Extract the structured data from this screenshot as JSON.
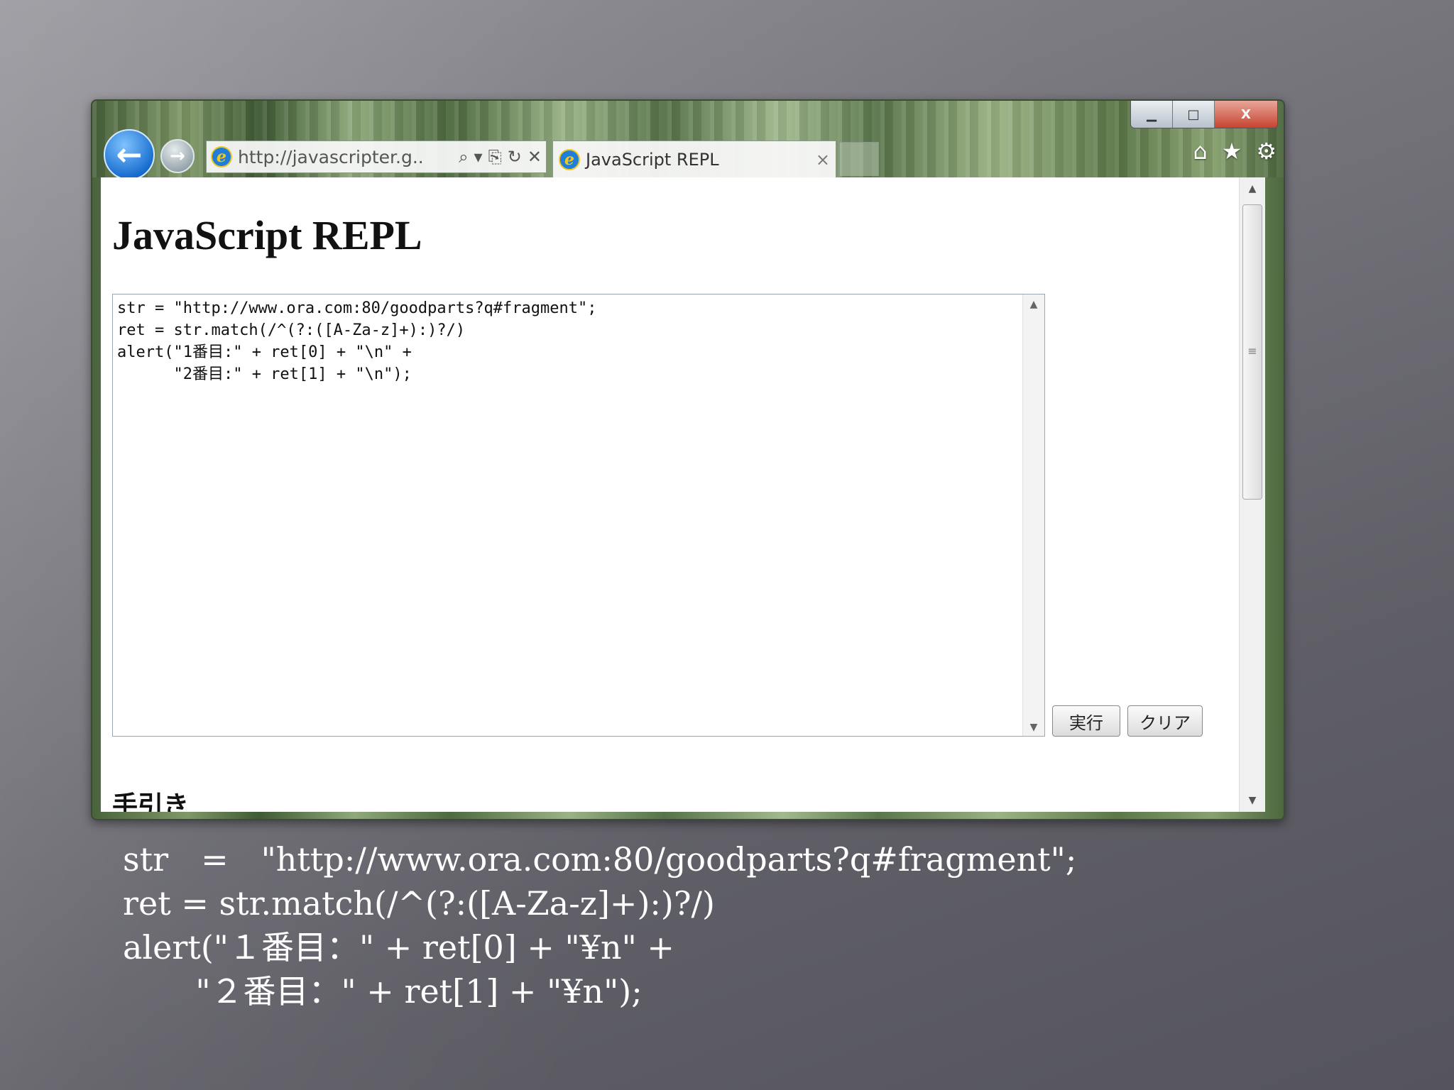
{
  "browser": {
    "window_controls": {
      "minimize": "▁",
      "maximize": "□",
      "close": "X"
    },
    "nav": {
      "back_icon": "←",
      "forward_icon": "→"
    },
    "address": {
      "url": "http://javascripter.g..",
      "search_icon": "⌕",
      "dropdown_icon": "▾",
      "compat_icon": "⎘",
      "refresh_icon": "↻",
      "stop_icon": "✕"
    },
    "tab": {
      "title": "JavaScript REPL",
      "close": "×"
    },
    "toolbar_icons": {
      "home": "⌂",
      "favorites": "★",
      "tools": "⚙"
    }
  },
  "page": {
    "title": "JavaScript REPL",
    "code": "str = \"http://www.ora.com:80/goodparts?q#fragment\";\nret = str.match(/^(?:([A-Za-z]+):)?/)\nalert(\"1番目:\" + ret[0] + \"\\n\" +\n      \"2番目:\" + ret[1] + \"\\n\");",
    "buttons": {
      "run": "実行",
      "clear": "クリア"
    },
    "subheading": "手引き",
    "scrollbar": {
      "up": "▲",
      "down": "▼",
      "grip": "≡"
    }
  },
  "caption": "str　=　\"http://www.ora.com:80/goodparts?q#fragment\";\nret = str.match(/^(?:([A-Za-z]+):)?/)\nalert(\"１番目：\" + ret[0] + \"¥n\" +\n       \"２番目：\" + ret[1] + \"¥n\");"
}
